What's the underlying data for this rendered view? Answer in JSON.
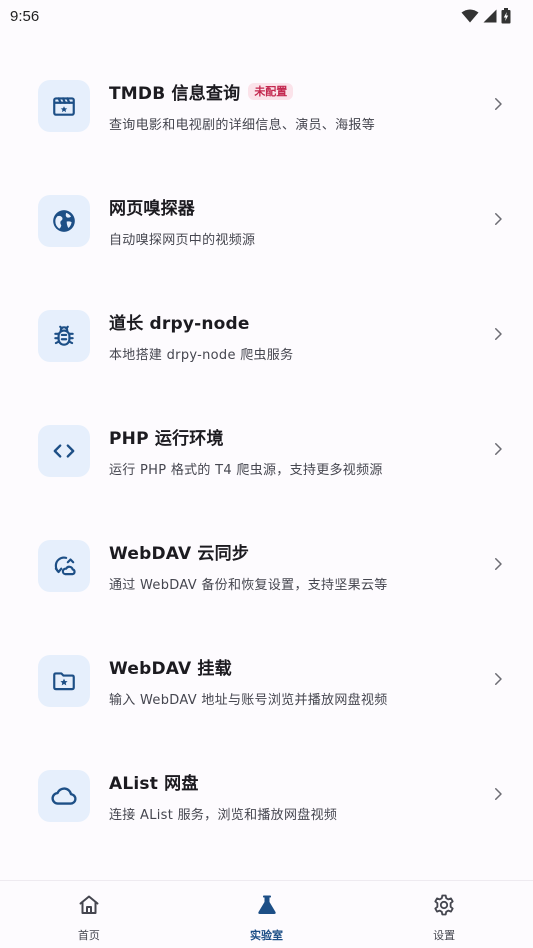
{
  "status_bar": {
    "time": "9:56",
    "icons": [
      "wifi-icon",
      "signal-icon",
      "battery-icon"
    ]
  },
  "colors": {
    "accent": "#1d4f86",
    "icon_bg": "#e6effc",
    "badge_text": "#c3284f",
    "badge_bg": "#fbe3ea"
  },
  "features": [
    {
      "icon": "movie-icon",
      "title": "TMDB 信息查询",
      "badge": "未配置",
      "subtitle": "查询电影和电视剧的详细信息、演员、海报等"
    },
    {
      "icon": "globe-icon",
      "title": "网页嗅探器",
      "subtitle": "自动嗅探网页中的视频源"
    },
    {
      "icon": "bug-icon",
      "title": "道长 drpy-node",
      "subtitle": "本地搭建 drpy-node 爬虫服务"
    },
    {
      "icon": "code-icon",
      "title": "PHP 运行环境",
      "subtitle": "运行 PHP 格式的 T4 爬虫源，支持更多视频源"
    },
    {
      "icon": "cloud-sync-icon",
      "title": "WebDAV 云同步",
      "subtitle": "通过 WebDAV 备份和恢复设置，支持坚果云等"
    },
    {
      "icon": "folder-star-icon",
      "title": "WebDAV 挂载",
      "subtitle": "输入 WebDAV 地址与账号浏览并播放网盘视频"
    },
    {
      "icon": "cloud-icon",
      "title": "AList 网盘",
      "subtitle": "连接 AList 服务，浏览和播放网盘视频"
    }
  ],
  "bottom_nav": {
    "active": "lab",
    "items": [
      {
        "id": "home",
        "icon": "home-icon",
        "label": "首页"
      },
      {
        "id": "lab",
        "icon": "flask-icon",
        "label": "实验室"
      },
      {
        "id": "settings",
        "icon": "gear-icon",
        "label": "设置"
      }
    ]
  }
}
